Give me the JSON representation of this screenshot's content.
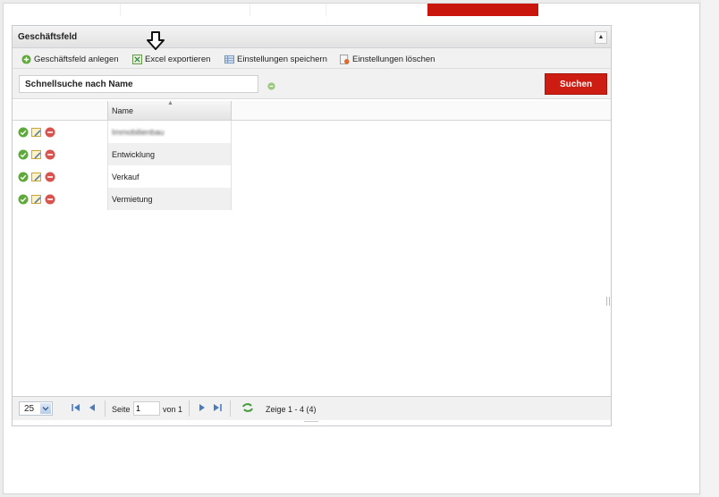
{
  "panel": {
    "title": "Geschäftsfeld"
  },
  "toolbar": {
    "add_label": "Geschäftsfeld anlegen",
    "export_label": "Excel exportieren",
    "save_settings_label": "Einstellungen speichern",
    "delete_settings_label": "Einstellungen löschen"
  },
  "search": {
    "placeholder": "Schnellsuche nach Name",
    "button_label": "Suchen"
  },
  "grid": {
    "column_name": "Name",
    "rows": [
      {
        "name": "Immobilienbau"
      },
      {
        "name": "Entwicklung"
      },
      {
        "name": "Verkauf"
      },
      {
        "name": "Vermietung"
      }
    ]
  },
  "pager": {
    "page_size": "25",
    "page_label": "Seite",
    "page_value": "1",
    "of_label": "von 1",
    "display_info": "Zeige 1 - 4 (4)"
  },
  "colors": {
    "accent_red": "#cd1d12",
    "ok_green": "#5ea93a",
    "delete_red": "#d9534f"
  }
}
